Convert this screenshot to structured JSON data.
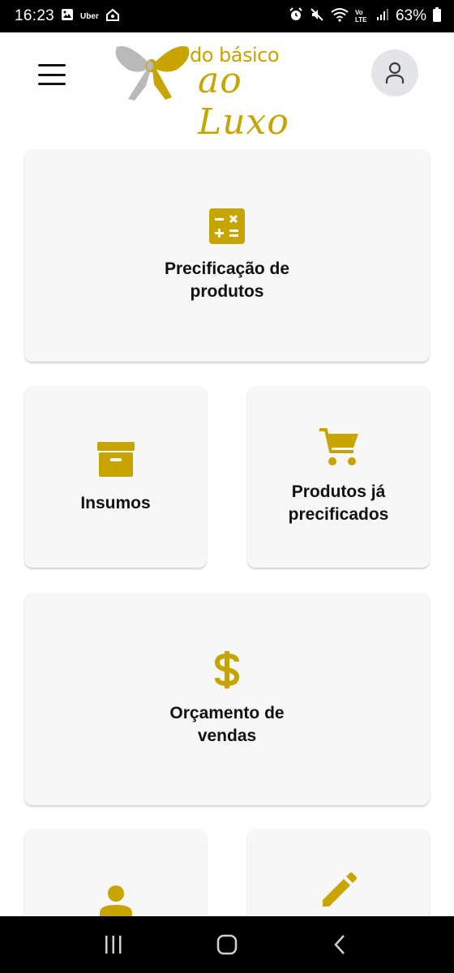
{
  "status_bar": {
    "time": "16:23",
    "uber_label": "Uber",
    "network_label": "Vo LTE",
    "battery_percent": "63%"
  },
  "header": {
    "logo_text_top": "do básico",
    "logo_text_bottom": "ao Luxo"
  },
  "cards": [
    {
      "label": "Precificação de\nprodutos",
      "icon": "calculator-icon"
    },
    {
      "label": "Insumos",
      "icon": "archive-box-icon"
    },
    {
      "label": "Produtos já\nprecificados",
      "icon": "shopping-cart-icon"
    },
    {
      "label": "Orçamento de\nvendas",
      "icon": "dollar-icon"
    },
    {
      "label": "",
      "icon": "person-icon"
    },
    {
      "label": "",
      "icon": "pencil-icon"
    }
  ],
  "colors": {
    "accent": "#c8a400",
    "card_bg": "#f7f7f7",
    "avatar_bg": "#e3e4e7"
  }
}
